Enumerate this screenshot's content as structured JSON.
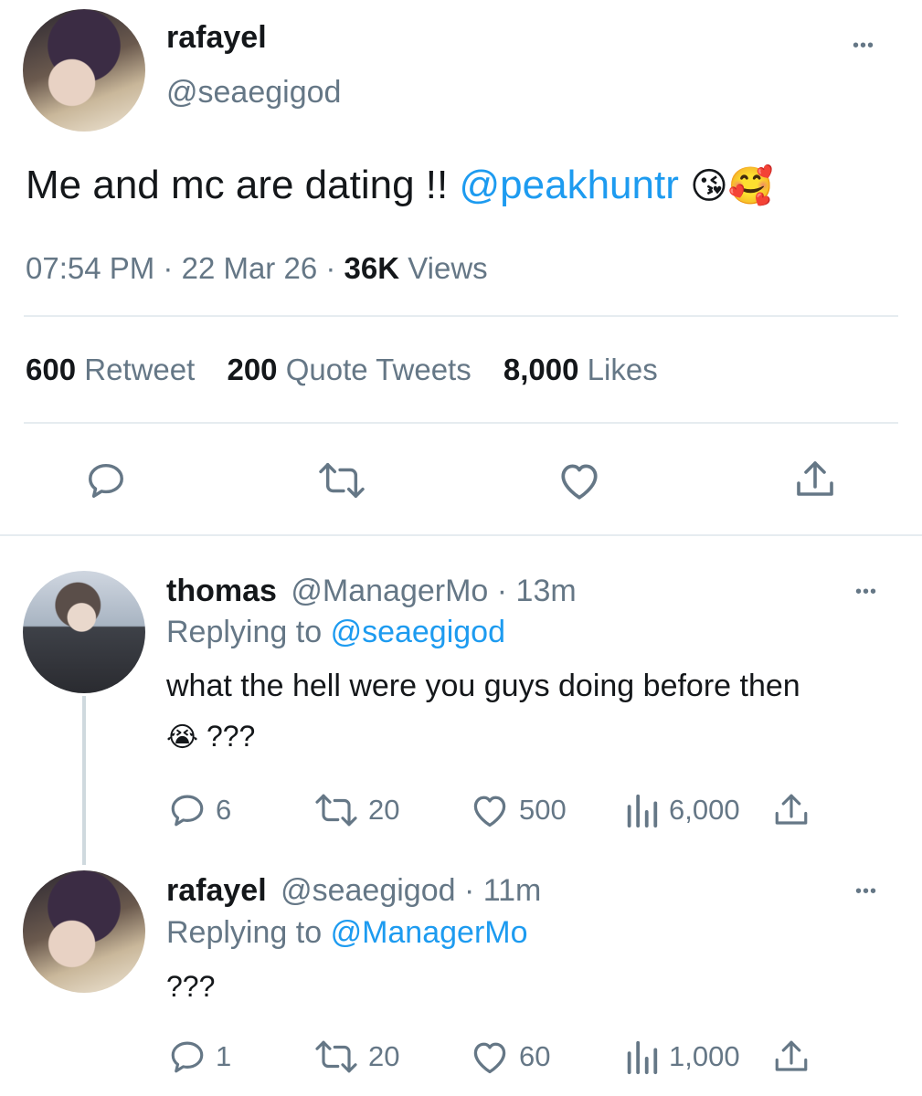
{
  "main_tweet": {
    "display_name": "rafayel",
    "handle": "@seaegigod",
    "text": "Me and mc are dating !!",
    "mention": "@peakhuntr",
    "emoji": "😘🥰",
    "time": "07:54 PM",
    "date": "22 Mar 26",
    "views_count": "36K",
    "views_label": "Views",
    "retweet_count": "600",
    "retweet_label": "Retweet",
    "quote_count": "200",
    "quote_label": "Quote Tweets",
    "like_count": "8,000",
    "like_label": "Likes"
  },
  "replies": [
    {
      "display_name": "thomas",
      "handle": "@ManagerMo",
      "time": "13m",
      "replying_label": "Replying to",
      "replying_to": "@seaegigod",
      "text_line1": "what the hell were you guys doing before then",
      "text_line2_emoji": "😭",
      "text_line2": "???",
      "reply_count": "6",
      "retweet_count": "20",
      "like_count": "500",
      "view_count": "6,000"
    },
    {
      "display_name": "rafayel",
      "handle": "@seaegigod",
      "time": "11m",
      "replying_label": "Replying to",
      "replying_to": "@ManagerMo",
      "text_line1": "???",
      "reply_count": "1",
      "retweet_count": "20",
      "like_count": "60",
      "view_count": "1,000"
    }
  ],
  "separator": "·",
  "more_glyph": "•••",
  "colors": {
    "link": "#1d9bf0",
    "secondary": "#657786",
    "divider": "#e6ecf0"
  }
}
